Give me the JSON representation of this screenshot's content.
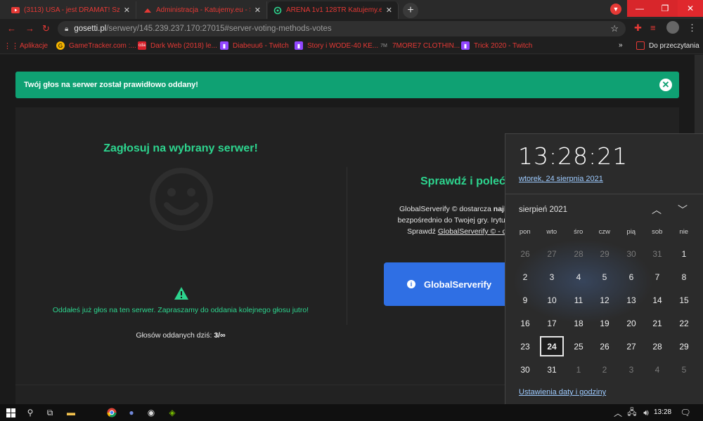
{
  "browser": {
    "tabs": [
      {
        "title": "(3113) USA - jest DRAMAT! Sz",
        "icon": "youtube-icon"
      },
      {
        "title": "Administracja - Katujemy.eu - Se",
        "icon": "site-icon"
      },
      {
        "title": "ARENA 1v1 128TR Katujemy.eu - Gos",
        "icon": "target-icon"
      }
    ],
    "address": {
      "host": "gosetti.pl",
      "path": "/serwery/145.239.237.170:27015#server-voting-methods-votes"
    },
    "bookmarks": [
      {
        "label": "Aplikacje",
        "icon": "apps-icon"
      },
      {
        "label": "GameTracker.com :...",
        "icon": "gametracker-icon"
      },
      {
        "label": "Dark Web (2018) le...",
        "icon": "cda-icon"
      },
      {
        "label": "Diabeuu6 - Twitch",
        "icon": "twitch-icon"
      },
      {
        "label": "Story i WODE-40 KE...",
        "icon": "twitch-icon"
      },
      {
        "label": "7MORE7 CLOTHIN...",
        "icon": "7more7-icon"
      },
      {
        "label": "Trick 2020 - Twitch",
        "icon": "twitch-icon"
      }
    ],
    "bookmarks_overflow": "»",
    "reading_list": "Do przeczytania"
  },
  "page": {
    "alert": "Twój głos na serwer został prawidłowo oddany!",
    "vote_title": "Zagłosuj na wybrany serwer!",
    "voted_message": "Oddałeś już głos na ten serwer. Zapraszamy do oddania kolejnego głosu jutro!",
    "votes_today_label": "Głosów oddanych dziś: ",
    "votes_today_value": "3/∞",
    "check_title": "Sprawdź i poleć",
    "desc_line1_pre": "GlobalServerify © dostarcza ",
    "desc_line1_bold": "najlepsze,",
    "desc_line2": "bezpośrednio do Twojej gry. Irytuje Cię n",
    "desc_line3_pre": "Sprawdź ",
    "desc_line3_link": "GlobalServerify © - dodat",
    "button": "GlobalServerify"
  },
  "calendar": {
    "time": "13:28:21",
    "date": "wtorek, 24 sierpnia 2021",
    "month": "sierpień 2021",
    "weekdays": [
      "pon",
      "wto",
      "śro",
      "czw",
      "pią",
      "sob",
      "nie"
    ],
    "weeks": [
      [
        "26",
        "27",
        "28",
        "29",
        "30",
        "31",
        "1"
      ],
      [
        "2",
        "3",
        "4",
        "5",
        "6",
        "7",
        "8"
      ],
      [
        "9",
        "10",
        "11",
        "12",
        "13",
        "14",
        "15"
      ],
      [
        "16",
        "17",
        "18",
        "19",
        "20",
        "21",
        "22"
      ],
      [
        "23",
        "24",
        "25",
        "26",
        "27",
        "28",
        "29"
      ],
      [
        "30",
        "31",
        "1",
        "2",
        "3",
        "4",
        "5"
      ]
    ],
    "today": "24",
    "settings": "Ustawienia daty i godziny"
  },
  "taskbar": {
    "time": "13:28",
    "icons": [
      "windows-start-icon",
      "search-icon",
      "task-view-icon",
      "file-explorer-icon",
      "chrome-icon",
      "discord-icon",
      "steam-icon",
      "nvidia-icon"
    ]
  },
  "colors": {
    "accent": "#2dd48e",
    "alert": "#0fa173",
    "button": "#2f6fe4",
    "browser_red": "#e53935"
  }
}
